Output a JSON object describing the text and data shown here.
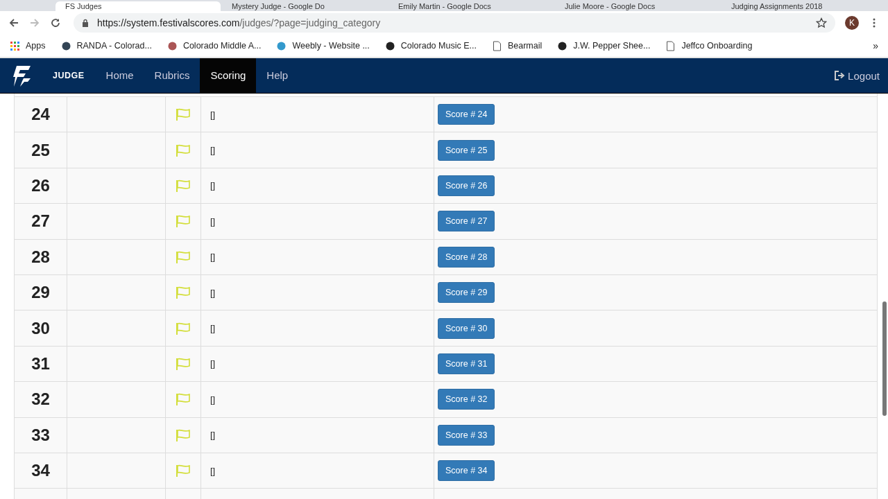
{
  "browser": {
    "tabs": [
      {
        "title": "FS Judges",
        "selected": true
      },
      {
        "title": "Mystery Judge - Google Do",
        "selected": false
      },
      {
        "title": "Emily Martin - Google Docs",
        "selected": false
      },
      {
        "title": "Julie Moore - Google Docs",
        "selected": false
      },
      {
        "title": "Judging Assignments 2018",
        "selected": false
      }
    ],
    "url_host": "https://system.festivalscores.com",
    "url_path": "/judges/?page=judging_category",
    "profile_initial": "K",
    "bookmarks": [
      "Apps",
      "RANDA - Colorad...",
      "Colorado Middle A...",
      "Weebly - Website ...",
      "Colorado Music E...",
      "Bearmail",
      "J.W. Pepper Shee...",
      "Jeffco Onboarding"
    ],
    "bookmarks_more": "»"
  },
  "navbar": {
    "brand": "JUDGE",
    "items": [
      {
        "label": "Home",
        "selected": false
      },
      {
        "label": "Rubrics",
        "selected": false
      },
      {
        "label": "Scoring",
        "selected": true
      },
      {
        "label": "Help",
        "selected": false
      }
    ],
    "logout": "Logout"
  },
  "table": {
    "rows": [
      {
        "number": "24",
        "note": "[]",
        "button": "Score # 24"
      },
      {
        "number": "25",
        "note": "[]",
        "button": "Score # 25"
      },
      {
        "number": "26",
        "note": "[]",
        "button": "Score # 26"
      },
      {
        "number": "27",
        "note": "[]",
        "button": "Score # 27"
      },
      {
        "number": "28",
        "note": "[]",
        "button": "Score # 28"
      },
      {
        "number": "29",
        "note": "[]",
        "button": "Score # 29"
      },
      {
        "number": "30",
        "note": "[]",
        "button": "Score # 30"
      },
      {
        "number": "31",
        "note": "[]",
        "button": "Score # 31"
      },
      {
        "number": "32",
        "note": "[]",
        "button": "Score # 32"
      },
      {
        "number": "33",
        "note": "[]",
        "button": "Score # 33"
      },
      {
        "number": "34",
        "note": "[]",
        "button": "Score # 34"
      }
    ]
  }
}
